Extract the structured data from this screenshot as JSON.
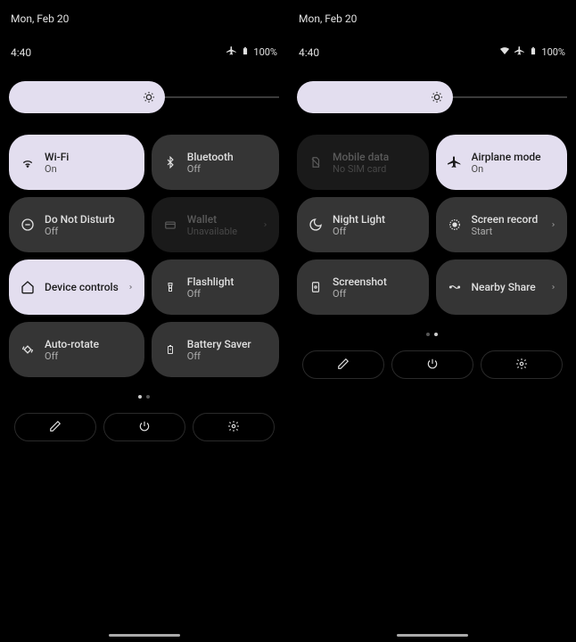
{
  "date": "Mon, Feb 20",
  "time": "4:40",
  "battery": "100%",
  "panels": [
    {
      "status": {
        "wifi": false,
        "airplane": true
      },
      "page_active": 0,
      "tiles": [
        {
          "name": "wifi",
          "title": "Wi-Fi",
          "sub": "On",
          "state": "on",
          "icon": "wifi",
          "chevron": false
        },
        {
          "name": "bluetooth",
          "title": "Bluetooth",
          "sub": "Off",
          "state": "off",
          "icon": "bluetooth",
          "chevron": false
        },
        {
          "name": "dnd",
          "title": "Do Not Disturb",
          "sub": "Off",
          "state": "off",
          "icon": "dnd",
          "chevron": false
        },
        {
          "name": "wallet",
          "title": "Wallet",
          "sub": "Unavailable",
          "state": "disabled",
          "icon": "wallet",
          "chevron": true
        },
        {
          "name": "device-controls",
          "title": "Device controls",
          "sub": "",
          "state": "on",
          "icon": "home",
          "chevron": true
        },
        {
          "name": "flashlight",
          "title": "Flashlight",
          "sub": "Off",
          "state": "off",
          "icon": "flashlight",
          "chevron": false
        },
        {
          "name": "auto-rotate",
          "title": "Auto-rotate",
          "sub": "Off",
          "state": "off",
          "icon": "rotate",
          "chevron": false
        },
        {
          "name": "battery-saver",
          "title": "Battery Saver",
          "sub": "Off",
          "state": "off",
          "icon": "battery",
          "chevron": false
        }
      ]
    },
    {
      "status": {
        "wifi": true,
        "airplane": true
      },
      "page_active": 1,
      "tiles": [
        {
          "name": "mobile-data",
          "title": "Mobile data",
          "sub": "No SIM card",
          "state": "disabled",
          "icon": "sim",
          "chevron": false
        },
        {
          "name": "airplane-mode",
          "title": "Airplane mode",
          "sub": "On",
          "state": "on",
          "icon": "airplane",
          "chevron": false
        },
        {
          "name": "night-light",
          "title": "Night Light",
          "sub": "Off",
          "state": "off",
          "icon": "moon",
          "chevron": false
        },
        {
          "name": "screen-record",
          "title": "Screen record",
          "sub": "Start",
          "state": "off",
          "icon": "record",
          "chevron": true
        },
        {
          "name": "screenshot",
          "title": "Screenshot",
          "sub": "Off",
          "state": "off",
          "icon": "screenshot",
          "chevron": false
        },
        {
          "name": "nearby-share",
          "title": "Nearby Share",
          "sub": "",
          "state": "off",
          "icon": "share",
          "chevron": true
        }
      ]
    }
  ],
  "colors": {
    "accent": "#e3deef",
    "tile_off": "#353535",
    "tile_disabled": "#1a1a1a"
  }
}
